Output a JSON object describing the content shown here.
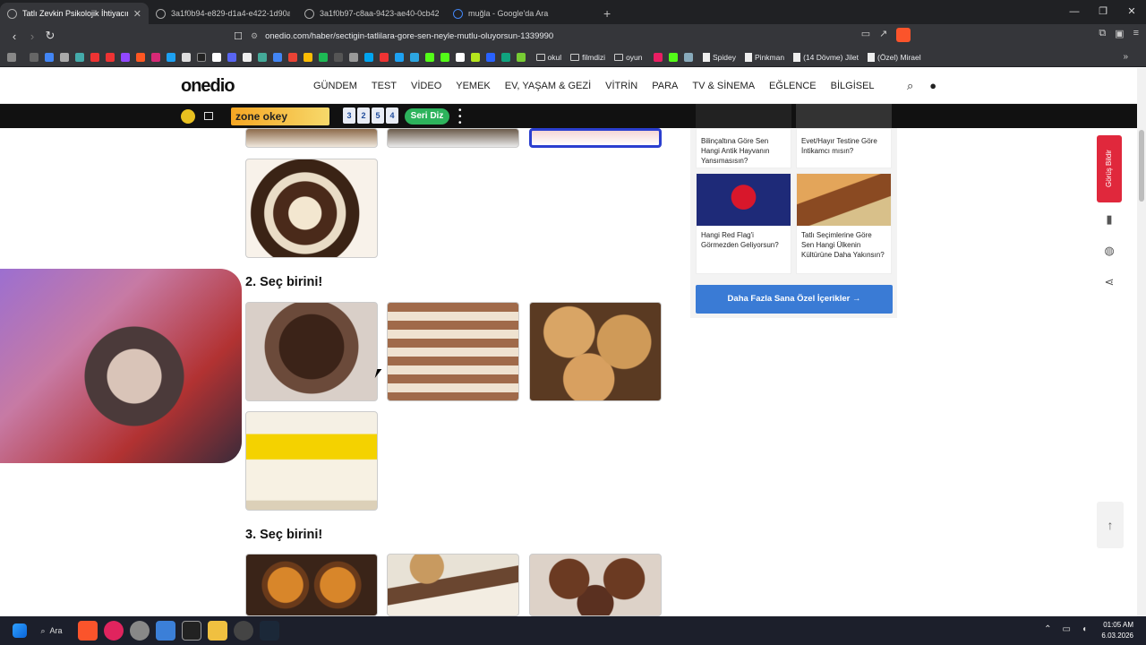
{
  "browser": {
    "tabs": [
      {
        "title": "Tatlı Zevkin Psikolojik İhtiyacını A",
        "active": true
      },
      {
        "title": "3a1f0b94-e829-d1a4-e422-1d90afb",
        "active": false
      },
      {
        "title": "3a1f0b97-c8aa-9423-ae40-0cb4209",
        "active": false
      },
      {
        "title": "muğla - Google'da Ara",
        "active": false
      }
    ],
    "url": "onedio.com/haber/sectigin-tatlilara-gore-sen-neyle-mutlu-oluyorsun-1339990",
    "bookmarks": [
      "okul",
      "filmdizi",
      "oyun",
      "Spidey",
      "Pinkman",
      "(14 Dövme) Jilet",
      "(Özel) Mirael"
    ]
  },
  "site": {
    "logo": "onedio",
    "menu": [
      "GÜNDEM",
      "TEST",
      "VİDEO",
      "YEMEK",
      "EV, YAŞAM & GEZİ",
      "VİTRİN",
      "PARA",
      "TV & SİNEMA",
      "EĞLENCE",
      "BİLGİSEL"
    ],
    "ad": {
      "brand": "zone okey",
      "tiles": [
        "3",
        "2",
        "5",
        "4"
      ],
      "cta": "Seri Diz"
    }
  },
  "content": {
    "q2_heading": "2. Seç birini!",
    "q3_heading": "3. Seç birini!"
  },
  "sidebar": {
    "cards": [
      {
        "title": "Bilinçaltına Göre Sen Hangi Antik Hayvanın Yansımasısın?"
      },
      {
        "title": "Evet/Hayır Testine Göre İntikamcı mısın?"
      },
      {
        "title": "Hangi Red Flag'i Görmezden Geliyorsun?"
      },
      {
        "title": "Tatlı Seçimlerine Göre Sen Hangi Ülkenin Kültürüne Daha Yakınsın?"
      }
    ],
    "more_button": "Daha Fazla Sana Özel İçerikler  →",
    "feedback": "Görüş Bildir"
  },
  "taskbar": {
    "search_label": "Ara",
    "time": "01:05 AM",
    "date": "6.03.2026"
  }
}
